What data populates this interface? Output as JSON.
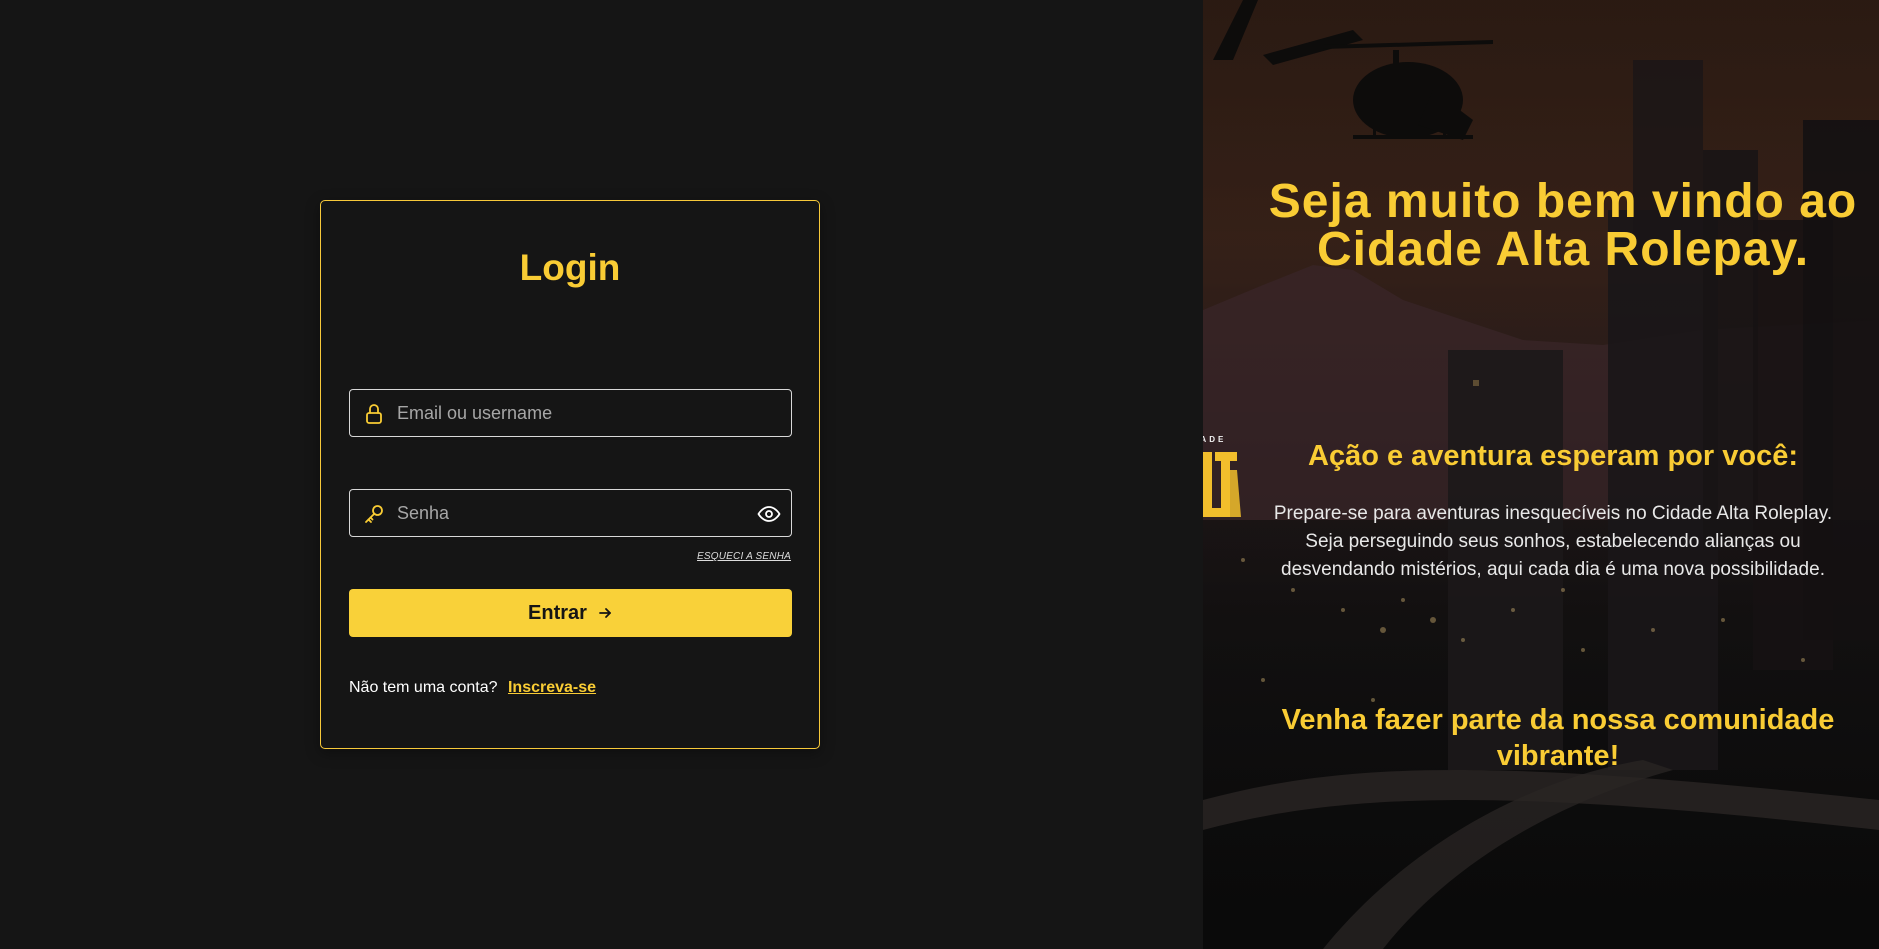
{
  "login": {
    "title": "Login",
    "username_placeholder": "Email ou username",
    "password_placeholder": "Senha",
    "forgot_password": "ESQUECI A SENHA",
    "submit_label": "Entrar",
    "signup_prompt": "Não tem uma conta?",
    "signup_link": "Inscreva-se"
  },
  "welcome": {
    "title": "Seja muito bem vindo ao Cidade Alta Rolepay.",
    "subtitle": "Ação e aventura esperam por você:",
    "description": "Prepare-se para aventuras inesquecíveis no Cidade Alta Roleplay. Seja perseguindo seus sonhos, estabelecendo alianças ou desvendando mistérios, aqui cada dia é uma nova possibilidade.",
    "cta": "Venha fazer parte da nossa comunidade vibrante!",
    "logo_top": "CIDADE",
    "logo_main": "ALTA"
  },
  "colors": {
    "accent": "#f9cc34",
    "background": "#151515",
    "button": "#f9d139"
  },
  "icons": {
    "username": "lock-icon",
    "password": "key-icon",
    "toggle_password": "eye-icon",
    "submit": "arrow-right-icon"
  }
}
